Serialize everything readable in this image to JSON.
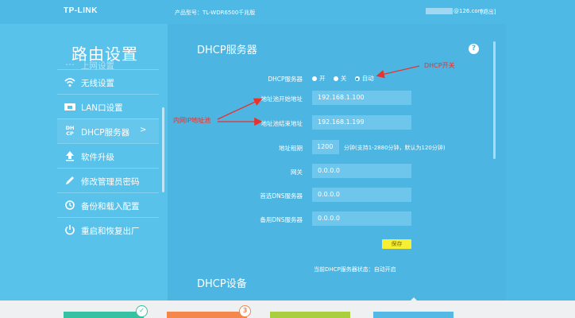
{
  "topbar": {
    "logo": "TP-LINK",
    "model": "产品型号：TL-WDR6500千兆版",
    "account_suffix": "@126.com",
    "logout": "[退出]"
  },
  "sidebar": {
    "title": "路由设置",
    "items": [
      {
        "icon": "globe-icon",
        "label": "上网设置"
      },
      {
        "icon": "wifi-icon",
        "label": "无线设置"
      },
      {
        "icon": "lan-port-icon",
        "label": "LAN口设置"
      },
      {
        "icon": "dhcp-icon",
        "icon_text": "DH CP",
        "label": "DHCP服务器",
        "arrow": ">"
      },
      {
        "icon": "upload-icon",
        "label": "软件升级"
      },
      {
        "icon": "pencil-icon",
        "label": "修改管理员密码"
      },
      {
        "icon": "backup-icon",
        "label": "备份和载入配置"
      },
      {
        "icon": "power-icon",
        "label": "重启和恢复出厂"
      }
    ]
  },
  "main": {
    "section_title": "DHCP服务器",
    "help": "?",
    "dhcp_server": {
      "label": "DHCP服务器",
      "options": [
        "开",
        "关",
        "自动"
      ],
      "selected": "自动"
    },
    "fields": {
      "start_label": "地址池开始地址",
      "start_value": "192.168.1.100",
      "end_label": "地址池结束地址",
      "end_value": "192.168.1.199",
      "lease_label": "地址租期",
      "lease_value": "1200",
      "lease_hint": "分钟(支持1-2880分钟，默认为120分钟)",
      "gateway_label": "网关",
      "gateway_value": "0.0.0.0",
      "dns1_label": "首选DNS服务器",
      "dns1_value": "0.0.0.0",
      "dns2_label": "备用DNS服务器",
      "dns2_value": "0.0.0.0"
    },
    "save": "保存",
    "status": "当前DHCP服务器状态：自动开启",
    "devices_title": "DHCP设备"
  },
  "annotations": {
    "dhcp_switch": "DHCP开关",
    "ip_pool": "内网IP地址池"
  },
  "bottom": {
    "badge_1": "✓",
    "badge_2": "3"
  },
  "colors": {
    "accent": "#4db5e2",
    "sidebar": "#59c2ea",
    "field": "#6fc6ec",
    "save": "#f7ef34",
    "annotation": "#e8322b",
    "card_green": "#35c2a2",
    "card_orange": "#f4874b",
    "card_lime": "#a9cf3f",
    "card_blue": "#54b9e4"
  }
}
